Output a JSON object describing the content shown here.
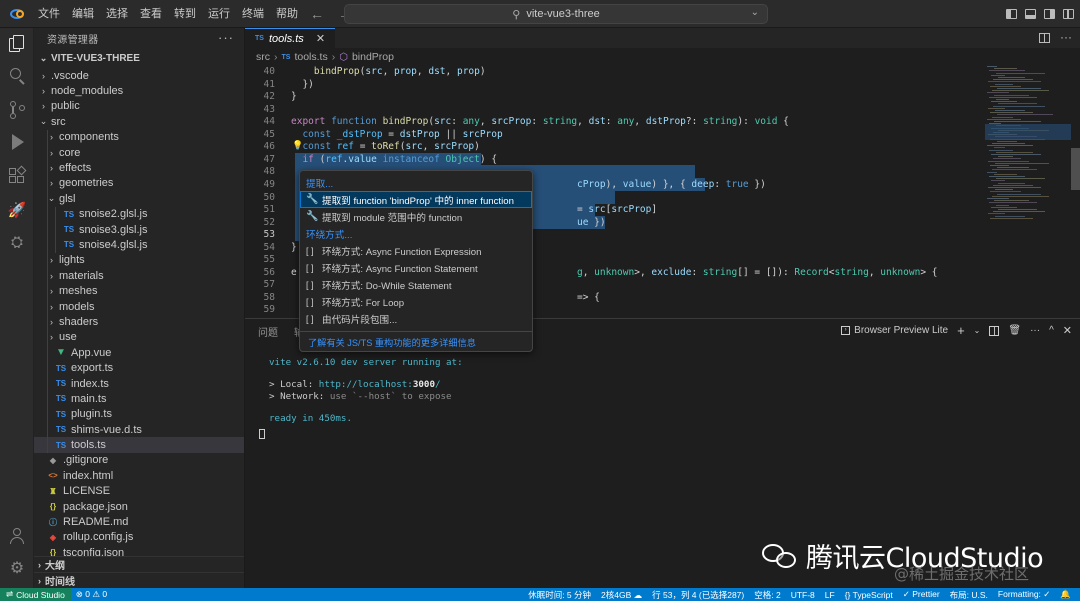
{
  "titlebar": {
    "menus": [
      "文件",
      "编辑",
      "选择",
      "查看",
      "转到",
      "运行",
      "终端",
      "帮助"
    ],
    "search_text": "vite-vue3-three"
  },
  "sidebar": {
    "title": "资源管理器",
    "root": "VITE-VUE3-THREE",
    "items": [
      {
        "label": ".vscode",
        "type": "folder",
        "depth": 1,
        "open": false
      },
      {
        "label": "node_modules",
        "type": "folder",
        "depth": 1,
        "open": false
      },
      {
        "label": "public",
        "type": "folder",
        "depth": 1,
        "open": false
      },
      {
        "label": "src",
        "type": "folder",
        "depth": 1,
        "open": true
      },
      {
        "label": "components",
        "type": "folder",
        "depth": 2,
        "open": false
      },
      {
        "label": "core",
        "type": "folder",
        "depth": 2,
        "open": false
      },
      {
        "label": "effects",
        "type": "folder",
        "depth": 2,
        "open": false
      },
      {
        "label": "geometries",
        "type": "folder",
        "depth": 2,
        "open": false
      },
      {
        "label": "glsl",
        "type": "folder",
        "depth": 2,
        "open": true
      },
      {
        "label": "snoise2.glsl.js",
        "type": "file",
        "icon": "TS",
        "depth": 3
      },
      {
        "label": "snoise3.glsl.js",
        "type": "file",
        "icon": "TS",
        "depth": 3
      },
      {
        "label": "snoise4.glsl.js",
        "type": "file",
        "icon": "TS",
        "depth": 3
      },
      {
        "label": "lights",
        "type": "folder",
        "depth": 2,
        "open": false
      },
      {
        "label": "materials",
        "type": "folder",
        "depth": 2,
        "open": false
      },
      {
        "label": "meshes",
        "type": "folder",
        "depth": 2,
        "open": false
      },
      {
        "label": "models",
        "type": "folder",
        "depth": 2,
        "open": false
      },
      {
        "label": "shaders",
        "type": "folder",
        "depth": 2,
        "open": false
      },
      {
        "label": "use",
        "type": "folder",
        "depth": 2,
        "open": false
      },
      {
        "label": "App.vue",
        "type": "file",
        "icon": "vue",
        "depth": 2
      },
      {
        "label": "export.ts",
        "type": "file",
        "icon": "TS",
        "depth": 2
      },
      {
        "label": "index.ts",
        "type": "file",
        "icon": "TS",
        "depth": 2
      },
      {
        "label": "main.ts",
        "type": "file",
        "icon": "TS",
        "depth": 2
      },
      {
        "label": "plugin.ts",
        "type": "file",
        "icon": "TS",
        "depth": 2
      },
      {
        "label": "shims-vue.d.ts",
        "type": "file",
        "icon": "TS",
        "depth": 2
      },
      {
        "label": "tools.ts",
        "type": "file",
        "icon": "TS",
        "depth": 2,
        "selected": true
      },
      {
        "label": ".gitignore",
        "type": "file",
        "icon": "git",
        "depth": 1
      },
      {
        "label": "index.html",
        "type": "file",
        "icon": "html",
        "depth": 1
      },
      {
        "label": "LICENSE",
        "type": "file",
        "icon": "license",
        "depth": 1
      },
      {
        "label": "package.json",
        "type": "file",
        "icon": "json",
        "depth": 1
      },
      {
        "label": "README.md",
        "type": "file",
        "icon": "info",
        "depth": 1
      },
      {
        "label": "rollup.config.js",
        "type": "file",
        "icon": "rollup",
        "depth": 1
      },
      {
        "label": "tsconfig.json",
        "type": "file",
        "icon": "json",
        "depth": 1
      }
    ],
    "outline_label": "大纲",
    "timeline_label": "时间线"
  },
  "editor": {
    "tab_badge": "TS",
    "tab_name": "tools.ts",
    "breadcrumb": {
      "folder": "src",
      "file_badge": "TS",
      "file": "tools.ts",
      "symbol": "bindProp"
    },
    "lines": [
      {
        "n": "40",
        "html": "    <span class='fn'>bindProp</span>(<span class='pm'>src</span>, <span class='pm'>prop</span>, <span class='pm'>dst</span>, <span class='pm'>prop</span>)"
      },
      {
        "n": "41",
        "html": "  })"
      },
      {
        "n": "42",
        "html": "}"
      },
      {
        "n": "43",
        "html": ""
      },
      {
        "n": "44",
        "html": "<span class='kw2'>export</span> <span class='kw'>function</span> <span class='fn'>bindProp</span>(<span class='pm'>src</span>: <span class='ty'>any</span>, <span class='pm'>srcProp</span>: <span class='ty'>string</span>, <span class='pm'>dst</span>: <span class='ty'>any</span>, <span class='pm'>dstProp</span>?: <span class='ty'>string</span>): <span class='ty'>void</span> {"
      },
      {
        "n": "45",
        "html": "  <span class='kw'>const</span> <span class='cn'>_dstProp</span> = <span class='pm'>dstProp</span> || <span class='pm'>srcProp</span>"
      },
      {
        "n": "46",
        "html": "  <span class='kw'>const</span> <span class='cn'>ref</span> = <span class='fn'>toRef</span>(<span class='pm'>src</span>, <span class='pm'>srcProp</span>)"
      },
      {
        "n": "47",
        "html": "  <span class='kw2'>if</span> (<span class='cn'>ref</span>.<span class='pm'>value</span> <span class='kw'>instanceof</span> <span class='ty'>Object</span>) {"
      },
      {
        "n": "48",
        "html": ""
      },
      {
        "n": "49",
        "html": "                                                  <span class='pm'>cProp</span>), <span class='pm'>value</span>) }, { <span class='pm'>deep</span>: <span class='kw'>true</span> })"
      },
      {
        "n": "50",
        "html": ""
      },
      {
        "n": "51",
        "html": "                                                  = <span class='pm'>src</span>[<span class='pm'>srcProp</span>]"
      },
      {
        "n": "52",
        "html": "                                                  <span class='pm'>ue</span> })"
      },
      {
        "n": "53",
        "html": ""
      },
      {
        "n": "54",
        "html": "}"
      },
      {
        "n": "55",
        "html": ""
      },
      {
        "n": "56",
        "html": "e                                                 <span class='ty'>g</span>, <span class='ty'>unknown</span>>, <span class='pm'>exclude</span>: <span class='ty'>string</span>[] = []): <span class='ty'>Record</span><<span class='ty'>string</span>, <span class='ty'>unknown</span>> {"
      },
      {
        "n": "57",
        "html": ""
      },
      {
        "n": "58",
        "html": "                                                  => {"
      },
      {
        "n": "59",
        "html": ""
      }
    ]
  },
  "context_menu": {
    "section_extract": "提取...",
    "items_extract": [
      "提取到 function 'bindProp' 中的 inner function",
      "提取到 module 范围中的 function"
    ],
    "section_surround": "环绕方式...",
    "items_surround": [
      "环绕方式: Async Function Expression",
      "环绕方式: Async Function Statement",
      "环绕方式: Do-While Statement",
      "环绕方式: For Loop",
      "由代码片段包围..."
    ],
    "footer": "了解有关 JS/TS 重构功能的更多详细信息"
  },
  "panel": {
    "tabs": [
      "问题",
      "输"
    ],
    "terminal_name": "Browser Preview Lite",
    "terminal": {
      "vite_line_name": "vite v2.6.10",
      "vite_line_rest": " dev server running at:",
      "local_label": "> Local: ",
      "local_url_a": "http://localhost:",
      "local_url_port": "3000",
      "local_url_b": "/",
      "network_label": "> Network: ",
      "network_text": "use `--host` to expose",
      "ready_line": "ready in 450ms."
    }
  },
  "statusbar": {
    "remote": "Cloud Studio",
    "problems": "⊗ 0 ⚠ 0",
    "right_items": [
      "休眠时间: 5 分钟",
      "2核4GB ☁",
      "行 53，列 4 (已选择287)",
      "空格: 2",
      "UTF-8",
      "LF",
      "{} TypeScript",
      "✓ Prettier",
      "布局: U.S.",
      "Formatting: ✓",
      "🔔"
    ]
  },
  "watermark": {
    "brand": "腾讯云CloudStudio",
    "sub": "@稀土掘金技术社区"
  }
}
